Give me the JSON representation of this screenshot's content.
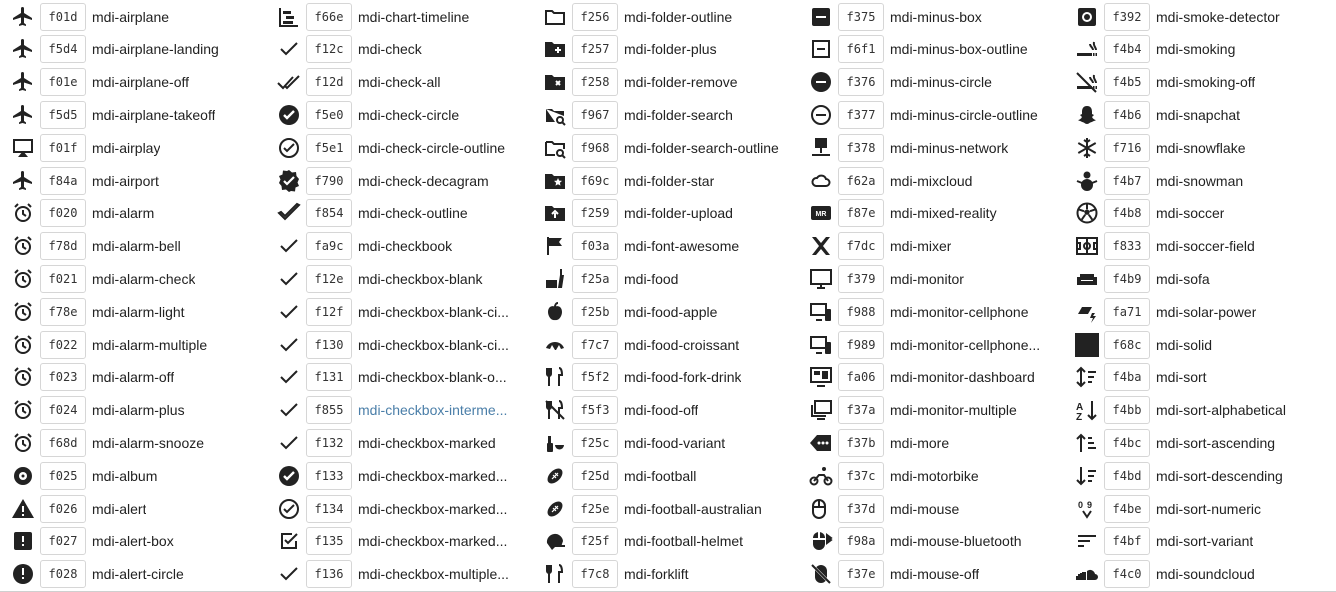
{
  "link_color": "#4a7ea8",
  "columns": [
    [
      {
        "icon": "airplane",
        "code": "f01d",
        "name": "mdi-airplane"
      },
      {
        "icon": "airplane-landing",
        "code": "f5d4",
        "name": "mdi-airplane-landing"
      },
      {
        "icon": "airplane-off",
        "code": "f01e",
        "name": "mdi-airplane-off"
      },
      {
        "icon": "airplane-takeoff",
        "code": "f5d5",
        "name": "mdi-airplane-takeoff"
      },
      {
        "icon": "airplay",
        "code": "f01f",
        "name": "mdi-airplay"
      },
      {
        "icon": "airport",
        "code": "f84a",
        "name": "mdi-airport"
      },
      {
        "icon": "alarm",
        "code": "f020",
        "name": "mdi-alarm"
      },
      {
        "icon": "alarm-bell",
        "code": "f78d",
        "name": "mdi-alarm-bell"
      },
      {
        "icon": "alarm-check",
        "code": "f021",
        "name": "mdi-alarm-check"
      },
      {
        "icon": "alarm-light",
        "code": "f78e",
        "name": "mdi-alarm-light"
      },
      {
        "icon": "alarm-multiple",
        "code": "f022",
        "name": "mdi-alarm-multiple"
      },
      {
        "icon": "alarm-off",
        "code": "f023",
        "name": "mdi-alarm-off"
      },
      {
        "icon": "alarm-plus",
        "code": "f024",
        "name": "mdi-alarm-plus"
      },
      {
        "icon": "alarm-snooze",
        "code": "f68d",
        "name": "mdi-alarm-snooze"
      },
      {
        "icon": "album",
        "code": "f025",
        "name": "mdi-album"
      },
      {
        "icon": "alert",
        "code": "f026",
        "name": "mdi-alert"
      },
      {
        "icon": "alert-box",
        "code": "f027",
        "name": "mdi-alert-box"
      },
      {
        "icon": "alert-circle",
        "code": "f028",
        "name": "mdi-alert-circle"
      }
    ],
    [
      {
        "icon": "chart-timeline",
        "code": "f66e",
        "name": "mdi-chart-timeline"
      },
      {
        "icon": "check",
        "code": "f12c",
        "name": "mdi-check"
      },
      {
        "icon": "check-all",
        "code": "f12d",
        "name": "mdi-check-all"
      },
      {
        "icon": "check-circle",
        "code": "f5e0",
        "name": "mdi-check-circle"
      },
      {
        "icon": "check-circle-outline",
        "code": "f5e1",
        "name": "mdi-check-circle-outline"
      },
      {
        "icon": "check-decagram",
        "code": "f790",
        "name": "mdi-check-decagram"
      },
      {
        "icon": "check-outline",
        "code": "f854",
        "name": "mdi-check-outline"
      },
      {
        "icon": "checkbook",
        "code": "fa9c",
        "name": "mdi-checkbook"
      },
      {
        "icon": "checkbox-blank",
        "code": "f12e",
        "name": "mdi-checkbox-blank"
      },
      {
        "icon": "checkbox-blank-circle",
        "code": "f12f",
        "name": "mdi-checkbox-blank-ci..."
      },
      {
        "icon": "checkbox-blank-circle-outline",
        "code": "f130",
        "name": "mdi-checkbox-blank-ci..."
      },
      {
        "icon": "checkbox-blank-outline",
        "code": "f131",
        "name": "mdi-checkbox-blank-o..."
      },
      {
        "icon": "checkbox-intermediate",
        "code": "f855",
        "name": "mdi-checkbox-interme...",
        "link": true
      },
      {
        "icon": "checkbox-marked",
        "code": "f132",
        "name": "mdi-checkbox-marked"
      },
      {
        "icon": "checkbox-marked-circle",
        "code": "f133",
        "name": "mdi-checkbox-marked..."
      },
      {
        "icon": "checkbox-marked-circle-outline",
        "code": "f134",
        "name": "mdi-checkbox-marked..."
      },
      {
        "icon": "checkbox-marked-outline",
        "code": "f135",
        "name": "mdi-checkbox-marked..."
      },
      {
        "icon": "checkbox-multiple",
        "code": "f136",
        "name": "mdi-checkbox-multiple..."
      }
    ],
    [
      {
        "icon": "folder-outline",
        "code": "f256",
        "name": "mdi-folder-outline"
      },
      {
        "icon": "folder-plus",
        "code": "f257",
        "name": "mdi-folder-plus"
      },
      {
        "icon": "folder-remove",
        "code": "f258",
        "name": "mdi-folder-remove"
      },
      {
        "icon": "folder-search",
        "code": "f967",
        "name": "mdi-folder-search"
      },
      {
        "icon": "folder-search-outline",
        "code": "f968",
        "name": "mdi-folder-search-outline"
      },
      {
        "icon": "folder-star",
        "code": "f69c",
        "name": "mdi-folder-star"
      },
      {
        "icon": "folder-upload",
        "code": "f259",
        "name": "mdi-folder-upload"
      },
      {
        "icon": "font-awesome",
        "code": "f03a",
        "name": "mdi-font-awesome"
      },
      {
        "icon": "food",
        "code": "f25a",
        "name": "mdi-food"
      },
      {
        "icon": "food-apple",
        "code": "f25b",
        "name": "mdi-food-apple"
      },
      {
        "icon": "food-croissant",
        "code": "f7c7",
        "name": "mdi-food-croissant"
      },
      {
        "icon": "food-fork-drink",
        "code": "f5f2",
        "name": "mdi-food-fork-drink"
      },
      {
        "icon": "food-off",
        "code": "f5f3",
        "name": "mdi-food-off"
      },
      {
        "icon": "food-variant",
        "code": "f25c",
        "name": "mdi-food-variant"
      },
      {
        "icon": "football",
        "code": "f25d",
        "name": "mdi-football"
      },
      {
        "icon": "football-australian",
        "code": "f25e",
        "name": "mdi-football-australian"
      },
      {
        "icon": "football-helmet",
        "code": "f25f",
        "name": "mdi-football-helmet"
      },
      {
        "icon": "forklift",
        "code": "f7c8",
        "name": "mdi-forklift"
      }
    ],
    [
      {
        "icon": "minus-box",
        "code": "f375",
        "name": "mdi-minus-box"
      },
      {
        "icon": "minus-box-outline",
        "code": "f6f1",
        "name": "mdi-minus-box-outline"
      },
      {
        "icon": "minus-circle",
        "code": "f376",
        "name": "mdi-minus-circle"
      },
      {
        "icon": "minus-circle-outline",
        "code": "f377",
        "name": "mdi-minus-circle-outline"
      },
      {
        "icon": "minus-network",
        "code": "f378",
        "name": "mdi-minus-network"
      },
      {
        "icon": "mixcloud",
        "code": "f62a",
        "name": "mdi-mixcloud"
      },
      {
        "icon": "mixed-reality",
        "code": "f87e",
        "name": "mdi-mixed-reality"
      },
      {
        "icon": "mixer",
        "code": "f7dc",
        "name": "mdi-mixer"
      },
      {
        "icon": "monitor",
        "code": "f379",
        "name": "mdi-monitor"
      },
      {
        "icon": "monitor-cellphone",
        "code": "f988",
        "name": "mdi-monitor-cellphone"
      },
      {
        "icon": "monitor-cellphone-star",
        "code": "f989",
        "name": "mdi-monitor-cellphone..."
      },
      {
        "icon": "monitor-dashboard",
        "code": "fa06",
        "name": "mdi-monitor-dashboard"
      },
      {
        "icon": "monitor-multiple",
        "code": "f37a",
        "name": "mdi-monitor-multiple"
      },
      {
        "icon": "more",
        "code": "f37b",
        "name": "mdi-more"
      },
      {
        "icon": "motorbike",
        "code": "f37c",
        "name": "mdi-motorbike"
      },
      {
        "icon": "mouse",
        "code": "f37d",
        "name": "mdi-mouse"
      },
      {
        "icon": "mouse-bluetooth",
        "code": "f98a",
        "name": "mdi-mouse-bluetooth"
      },
      {
        "icon": "mouse-off",
        "code": "f37e",
        "name": "mdi-mouse-off"
      }
    ],
    [
      {
        "icon": "smoke-detector",
        "code": "f392",
        "name": "mdi-smoke-detector"
      },
      {
        "icon": "smoking",
        "code": "f4b4",
        "name": "mdi-smoking"
      },
      {
        "icon": "smoking-off",
        "code": "f4b5",
        "name": "mdi-smoking-off"
      },
      {
        "icon": "snapchat",
        "code": "f4b6",
        "name": "mdi-snapchat"
      },
      {
        "icon": "snowflake",
        "code": "f716",
        "name": "mdi-snowflake"
      },
      {
        "icon": "snowman",
        "code": "f4b7",
        "name": "mdi-snowman"
      },
      {
        "icon": "soccer",
        "code": "f4b8",
        "name": "mdi-soccer"
      },
      {
        "icon": "soccer-field",
        "code": "f833",
        "name": "mdi-soccer-field"
      },
      {
        "icon": "sofa",
        "code": "f4b9",
        "name": "mdi-sofa"
      },
      {
        "icon": "solar-power",
        "code": "fa71",
        "name": "mdi-solar-power"
      },
      {
        "icon": "solid",
        "code": "f68c",
        "name": "mdi-solid"
      },
      {
        "icon": "sort",
        "code": "f4ba",
        "name": "mdi-sort"
      },
      {
        "icon": "sort-alphabetical",
        "code": "f4bb",
        "name": "mdi-sort-alphabetical"
      },
      {
        "icon": "sort-ascending",
        "code": "f4bc",
        "name": "mdi-sort-ascending"
      },
      {
        "icon": "sort-descending",
        "code": "f4bd",
        "name": "mdi-sort-descending"
      },
      {
        "icon": "sort-numeric",
        "code": "f4be",
        "name": "mdi-sort-numeric"
      },
      {
        "icon": "sort-variant",
        "code": "f4bf",
        "name": "mdi-sort-variant"
      },
      {
        "icon": "soundcloud",
        "code": "f4c0",
        "name": "mdi-soundcloud"
      }
    ]
  ]
}
